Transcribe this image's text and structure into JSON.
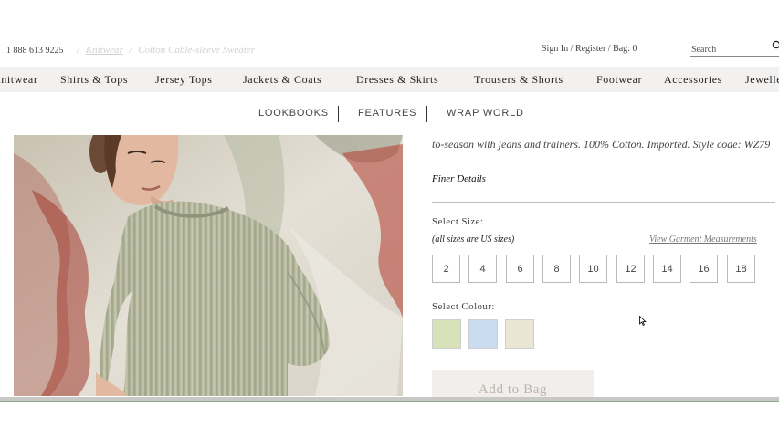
{
  "header": {
    "phone": "1 888 613 9225",
    "breadcrumb": {
      "sep1": "/",
      "current_category": "Knitwear",
      "sep2": "/",
      "current_page": "Cotton Cable-sleeve Sweater"
    },
    "account": {
      "sign_in": "Sign In",
      "sep1": " / ",
      "register": "Register",
      "sep2": " / ",
      "bag": "Bag: 0"
    },
    "search": {
      "placeholder": "Search"
    }
  },
  "category_nav": [
    "Knitwear",
    "Shirts & Tops",
    "Jersey Tops",
    "Jackets & Coats",
    "Dresses & Skirts",
    "Trousers & Shorts",
    "Footwear",
    "Accessories",
    "Jewellery"
  ],
  "sub_nav": [
    "LOOKBOOKS",
    "FEATURES",
    "WRAP WORLD"
  ],
  "product": {
    "description": "to-season with jeans and trainers. 100% Cotton. Imported. Style code: WZ79",
    "finer_details": "Finer Details",
    "select_size_label": "Select Size:",
    "size_note": "(all sizes are US sizes)",
    "garment_link": "View Garment Measurements",
    "sizes": [
      "2",
      "4",
      "6",
      "8",
      "10",
      "12",
      "14",
      "16",
      "18"
    ],
    "select_colour_label": "Select Colour:",
    "colours": [
      "#d7e2b8",
      "#c9dcf0",
      "#e9e6d3"
    ],
    "add_to_bag": "Add to Bag"
  }
}
